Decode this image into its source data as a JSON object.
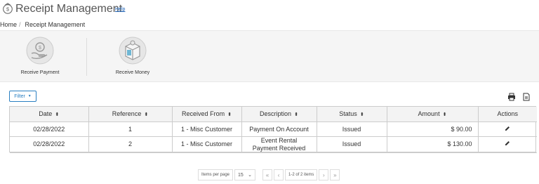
{
  "header": {
    "title": "Receipt Management",
    "help_label": "Help"
  },
  "breadcrumb": {
    "home": "Home",
    "separator": "/",
    "current": "Receipt Management"
  },
  "tiles": [
    {
      "label": "Receive Payment",
      "icon": "receive-payment-icon"
    },
    {
      "label": "Receive Money",
      "icon": "receive-money-icon"
    }
  ],
  "toolbar": {
    "filter_label": "Filter",
    "print_icon": "printer-icon",
    "export_icon": "export-icon"
  },
  "table": {
    "columns": [
      "Date",
      "Reference",
      "Received From",
      "Description",
      "Status",
      "Amount",
      "Actions"
    ],
    "rows": [
      {
        "date": "02/28/2022",
        "reference": "1",
        "received_from": "1 - Misc Customer",
        "description_line1": "Payment On Account",
        "description_line2": "",
        "status": "Issued",
        "amount": "$ 90.00"
      },
      {
        "date": "02/28/2022",
        "reference": "2",
        "received_from": "1 - Misc Customer",
        "description_line1": "Event Rental",
        "description_line2": "Payment Received",
        "status": "Issued",
        "amount": "$ 130.00"
      }
    ]
  },
  "pager": {
    "items_per_page_label": "Items per page",
    "page_size": "15",
    "range_info": "1-2 of 2 items",
    "first": "«",
    "prev": "‹",
    "next": "›",
    "last": "»"
  },
  "colors": {
    "accent": "#2a7fc1",
    "help_link": "#1a5fb4"
  }
}
